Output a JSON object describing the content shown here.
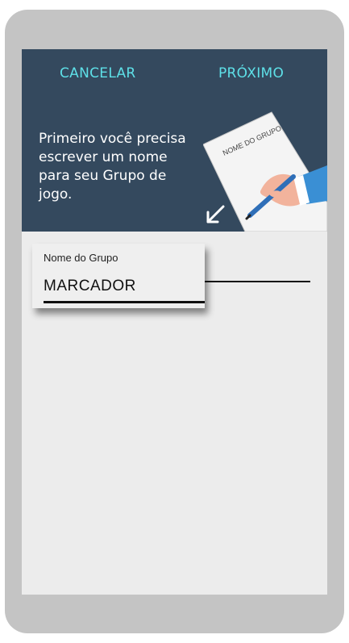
{
  "toolbar": {
    "cancel_label": "CANCELAR",
    "next_label": "PRÓXIMO"
  },
  "header": {
    "intro_text": "Primeiro você precisa escrever um nome para seu Grupo de jogo.",
    "illustration_caption": "NOME DO GRUPO"
  },
  "form": {
    "group_name_label": "Nome do Grupo",
    "group_name_value": "MARCADOR"
  },
  "colors": {
    "header_bg": "#34495e",
    "accent": "#5ee0e8",
    "screen_bg": "#ececec",
    "frame": "#c4c4c4"
  },
  "icons": {
    "arrow": "arrow-down-left-icon",
    "illustration": "hand-writing-paper-illustration"
  }
}
